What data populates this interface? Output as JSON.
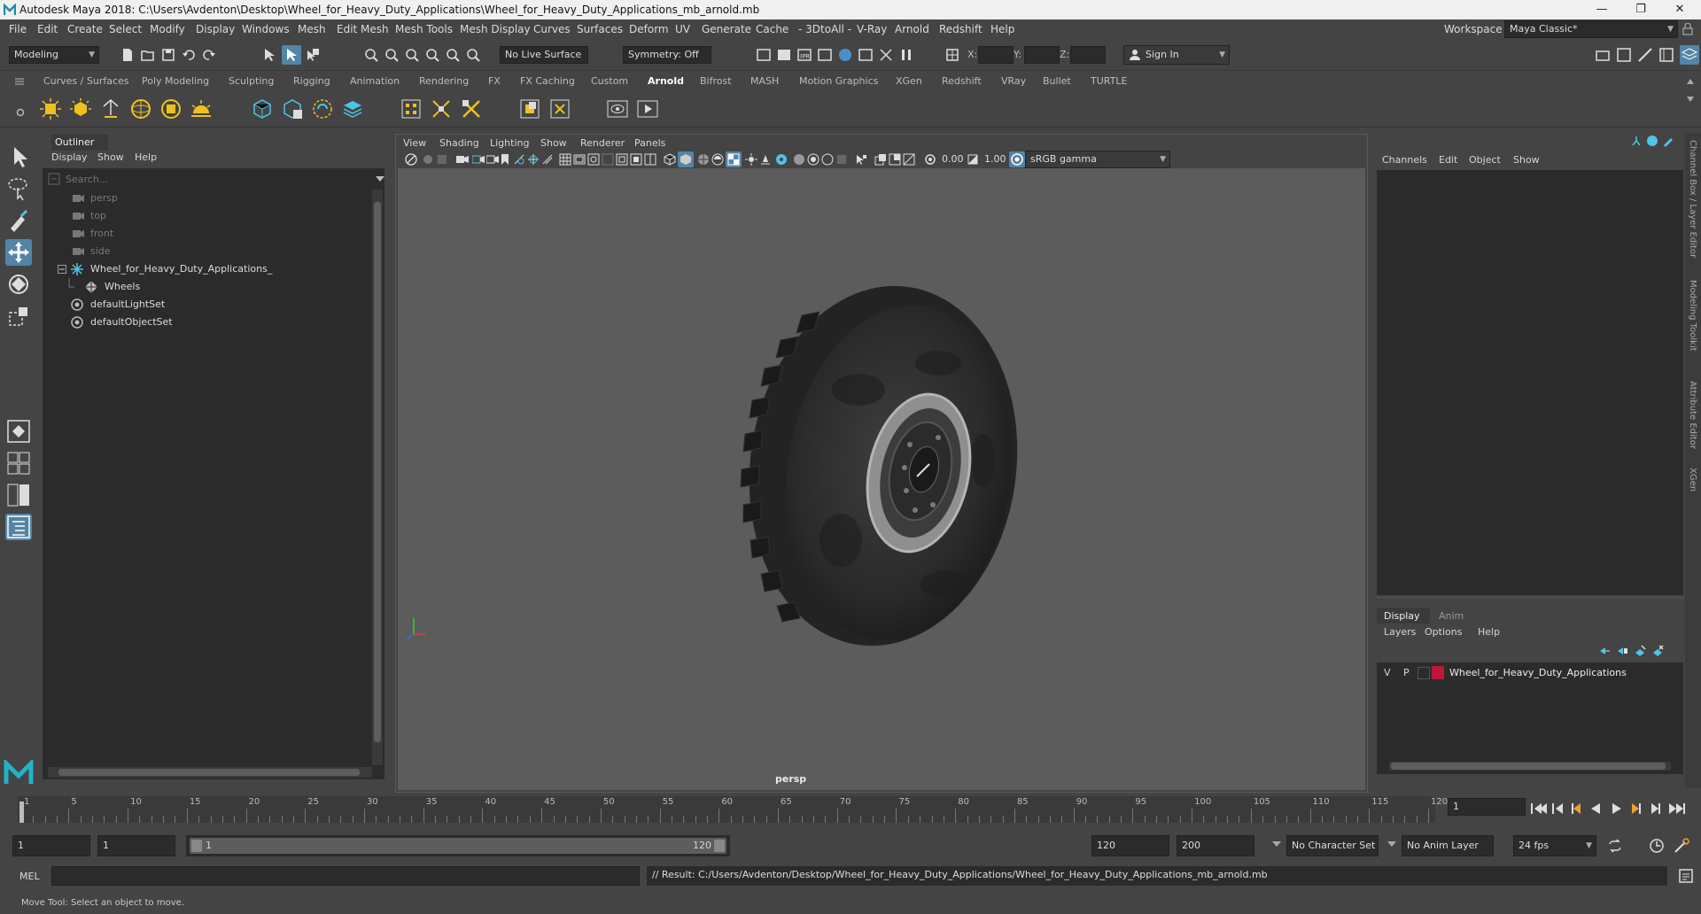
{
  "title_bar": {
    "text": "Autodesk Maya 2018: C:\\Users\\Avdenton\\Desktop\\Wheel_for_Heavy_Duty_Applications\\Wheel_for_Heavy_Duty_Applications_mb_arnold.mb",
    "minimize": "—",
    "maximize": "❐",
    "close": "✕"
  },
  "menu": [
    "File",
    "Edit",
    "Create",
    "Select",
    "Modify",
    "Display",
    "Windows",
    "Mesh",
    "Edit Mesh",
    "Mesh Tools",
    "Mesh Display",
    "Curves",
    "Surfaces",
    "Deform",
    "UV",
    "Generate",
    "Cache",
    "- 3DtoAll -",
    "V-Ray",
    "Arnold",
    "Redshift",
    "Help"
  ],
  "workspace": {
    "label": "Workspace :",
    "value": "Maya Classic*"
  },
  "status_line": {
    "mode": "Modeling",
    "live_surface": "No Live Surface",
    "symmetry": "Symmetry: Off",
    "x_label": "X:",
    "y_label": "Y:",
    "z_label": "Z:",
    "sign_in": "Sign In"
  },
  "shelf_tabs": [
    "Curves / Surfaces",
    "Poly Modeling",
    "Sculpting",
    "Rigging",
    "Animation",
    "Rendering",
    "FX",
    "FX Caching",
    "Custom",
    "Arnold",
    "Bifrost",
    "MASH",
    "Motion Graphics",
    "XGen",
    "Redshift",
    "VRay",
    "Bullet",
    "TURTLE"
  ],
  "active_shelf_tab": "Arnold",
  "outliner": {
    "title": "Outliner",
    "menu": [
      "Display",
      "Show",
      "Help"
    ],
    "search_placeholder": "Search...",
    "items": [
      {
        "label": "persp",
        "type": "camera",
        "dim": true
      },
      {
        "label": "top",
        "type": "camera",
        "dim": true
      },
      {
        "label": "front",
        "type": "camera",
        "dim": true
      },
      {
        "label": "side",
        "type": "camera",
        "dim": true
      },
      {
        "label": "Wheel_for_Heavy_Duty_Applications_",
        "type": "group",
        "dim": false
      },
      {
        "label": "Wheels",
        "type": "mesh",
        "dim": false
      },
      {
        "label": "defaultLightSet",
        "type": "set",
        "dim": false
      },
      {
        "label": "defaultObjectSet",
        "type": "set",
        "dim": false
      }
    ]
  },
  "viewport": {
    "menu": [
      "View",
      "Shading",
      "Lighting",
      "Show",
      "Renderer",
      "Panels"
    ],
    "exposure": "0.00",
    "gamma": "1.00",
    "color_space": "sRGB gamma",
    "camera_label": "persp"
  },
  "channel_box": {
    "menu": [
      "Channels",
      "Edit",
      "Object",
      "Show"
    ]
  },
  "layer_editor": {
    "tabs": [
      "Display",
      "Anim"
    ],
    "menu": [
      "Layers",
      "Options",
      "Help"
    ],
    "layer": {
      "v": "V",
      "p": "P",
      "color": "#c0163a",
      "name": "Wheel_for_Heavy_Duty_Applications"
    }
  },
  "side_tabs": [
    "Channel Box / Layer Editor",
    "Modeling Toolkit",
    "Attribute Editor",
    "XGen"
  ],
  "timeslider": {
    "ticks": [
      "1",
      "5",
      "10",
      "15",
      "20",
      "25",
      "30",
      "35",
      "40",
      "45",
      "50",
      "55",
      "60",
      "65",
      "70",
      "75",
      "80",
      "85",
      "90",
      "95",
      "100",
      "105",
      "110",
      "115",
      "120"
    ],
    "current_frame": "1"
  },
  "range": {
    "start": "1",
    "anim_start": "1",
    "range_start": "1",
    "range_end": "120",
    "end": "120",
    "anim_end": "200",
    "character_set": "No Character Set",
    "anim_layer": "No Anim Layer",
    "fps": "24 fps"
  },
  "command_line": {
    "label": "MEL",
    "result": "// Result: C:/Users/Avdenton/Desktop/Wheel_for_Heavy_Duty_Applications/Wheel_for_Heavy_Duty_Applications_mb_arnold.mb"
  },
  "help_line": "Move Tool: Select an object to move.",
  "colors": {
    "accent": "#5285a6",
    "selected_blue": "#4a90c8",
    "maya_logo": "#22b2c8",
    "layer_red": "#c0163a"
  }
}
